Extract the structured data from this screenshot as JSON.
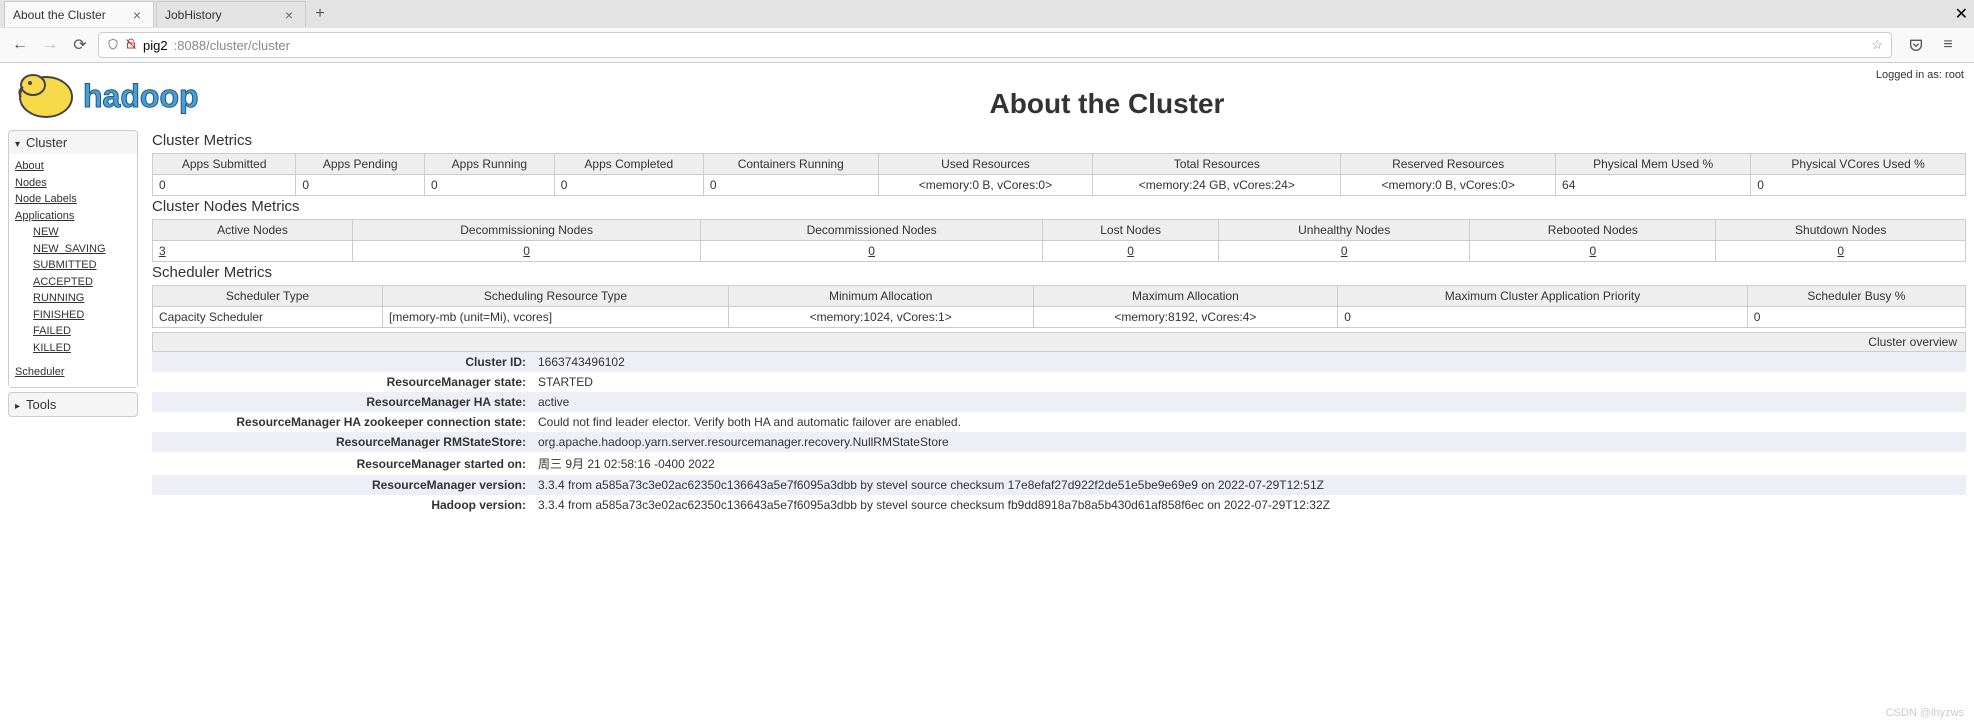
{
  "browser": {
    "tabs": [
      {
        "title": "About the Cluster",
        "active": true
      },
      {
        "title": "JobHistory",
        "active": false
      }
    ],
    "url_host": "pig2",
    "url_rest": ":8088/cluster/cluster"
  },
  "logged_in": "Logged in as: root",
  "page_title": "About the Cluster",
  "sidebar": {
    "cluster_header": "Cluster",
    "cluster_links": {
      "about": "About",
      "nodes": "Nodes",
      "node_labels": "Node Labels",
      "applications": "Applications",
      "app_states": {
        "new": "NEW",
        "new_saving": "NEW_SAVING",
        "submitted": "SUBMITTED",
        "accepted": "ACCEPTED",
        "running": "RUNNING",
        "finished": "FINISHED",
        "failed": "FAILED",
        "killed": "KILLED"
      },
      "scheduler": "Scheduler"
    },
    "tools_header": "Tools"
  },
  "cluster_metrics": {
    "title": "Cluster Metrics",
    "headers": {
      "apps_submitted": "Apps Submitted",
      "apps_pending": "Apps Pending",
      "apps_running": "Apps Running",
      "apps_completed": "Apps Completed",
      "containers_running": "Containers Running",
      "used_resources": "Used Resources",
      "total_resources": "Total Resources",
      "reserved_resources": "Reserved Resources",
      "phys_mem": "Physical Mem Used %",
      "phys_vcores": "Physical VCores Used %"
    },
    "row": {
      "apps_submitted": "0",
      "apps_pending": "0",
      "apps_running": "0",
      "apps_completed": "0",
      "containers_running": "0",
      "used_resources": "<memory:0 B, vCores:0>",
      "total_resources": "<memory:24 GB, vCores:24>",
      "reserved_resources": "<memory:0 B, vCores:0>",
      "phys_mem": "64",
      "phys_vcores": "0"
    }
  },
  "nodes_metrics": {
    "title": "Cluster Nodes Metrics",
    "headers": {
      "active": "Active Nodes",
      "decommissioning": "Decommissioning Nodes",
      "decommissioned": "Decommissioned Nodes",
      "lost": "Lost Nodes",
      "unhealthy": "Unhealthy Nodes",
      "rebooted": "Rebooted Nodes",
      "shutdown": "Shutdown Nodes"
    },
    "row": {
      "active": "3",
      "decommissioning": "0",
      "decommissioned": "0",
      "lost": "0",
      "unhealthy": "0",
      "rebooted": "0",
      "shutdown": "0"
    }
  },
  "scheduler_metrics": {
    "title": "Scheduler Metrics",
    "headers": {
      "type": "Scheduler Type",
      "resource_type": "Scheduling Resource Type",
      "min_alloc": "Minimum Allocation",
      "max_alloc": "Maximum Allocation",
      "max_priority": "Maximum Cluster Application Priority",
      "busy": "Scheduler Busy %"
    },
    "row": {
      "type": "Capacity Scheduler",
      "resource_type": "[memory-mb (unit=Mi), vcores]",
      "min_alloc": "<memory:1024, vCores:1>",
      "max_alloc": "<memory:8192, vCores:4>",
      "max_priority": "0",
      "busy": "0"
    }
  },
  "overview": {
    "title": "Cluster overview",
    "rows": {
      "cluster_id_label": "Cluster ID:",
      "cluster_id": "1663743496102",
      "rm_state_label": "ResourceManager state:",
      "rm_state": "STARTED",
      "rm_ha_state_label": "ResourceManager HA state:",
      "rm_ha_state": "active",
      "rm_ha_zk_label": "ResourceManager HA zookeeper connection state:",
      "rm_ha_zk": "Could not find leader elector. Verify both HA and automatic failover are enabled.",
      "rm_store_label": "ResourceManager RMStateStore:",
      "rm_store": "org.apache.hadoop.yarn.server.resourcemanager.recovery.NullRMStateStore",
      "rm_started_label": "ResourceManager started on:",
      "rm_started": "周三 9月 21 02:58:16 -0400 2022",
      "rm_version_label": "ResourceManager version:",
      "rm_version": "3.3.4 from a585a73c3e02ac62350c136643a5e7f6095a3dbb by stevel source checksum 17e8efaf27d922f2de51e5be9e69e9 on 2022-07-29T12:51Z",
      "hadoop_version_label": "Hadoop version:",
      "hadoop_version": "3.3.4 from a585a73c3e02ac62350c136643a5e7f6095a3dbb by stevel source checksum fb9dd8918a7b8a5b430d61af858f6ec on 2022-07-29T12:32Z"
    }
  },
  "watermark": "CSDN @lhyzws"
}
